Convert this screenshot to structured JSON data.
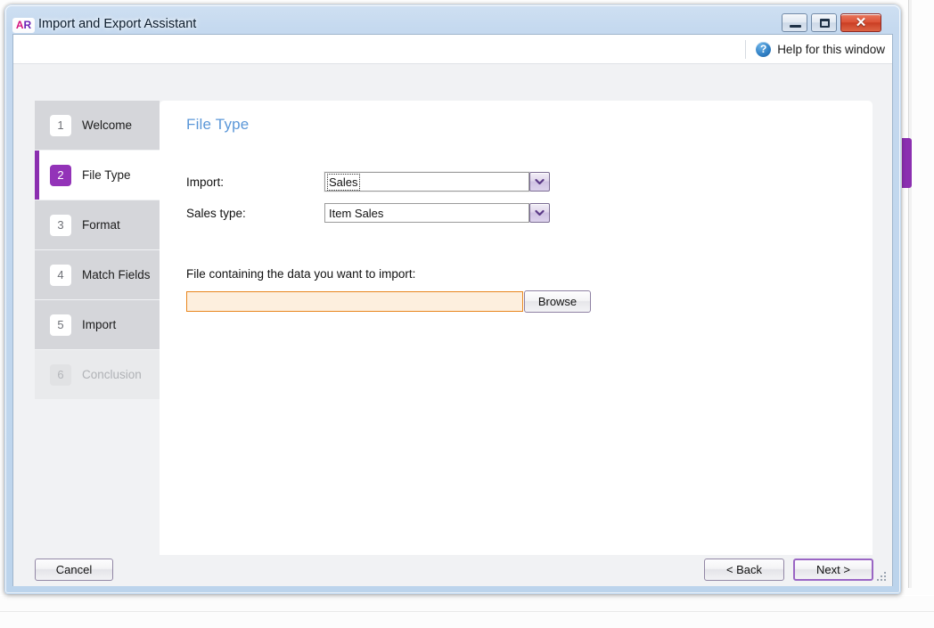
{
  "window": {
    "logo_text_1": "AR",
    "logo_part_a": "A",
    "logo_part_r": "R",
    "title": "Import and Export Assistant",
    "controls": {
      "minimize": "Minimize",
      "maximize": "Maximize",
      "close": "✕"
    }
  },
  "help": {
    "icon": "question-mark-icon",
    "icon_glyph": "?",
    "label": "Help for this window"
  },
  "sidebar": {
    "items": [
      {
        "number": "1",
        "label": "Welcome",
        "state": "normal"
      },
      {
        "number": "2",
        "label": "File Type",
        "state": "active"
      },
      {
        "number": "3",
        "label": "Format",
        "state": "normal"
      },
      {
        "number": "4",
        "label": "Match Fields",
        "state": "normal"
      },
      {
        "number": "5",
        "label": "Import",
        "state": "normal"
      },
      {
        "number": "6",
        "label": "Conclusion",
        "state": "disabled"
      }
    ]
  },
  "main": {
    "heading": "File Type",
    "fields": {
      "import": {
        "label": "Import:",
        "value": "Sales",
        "focused": true
      },
      "sales_type": {
        "label": "Sales type:",
        "value": "Item Sales",
        "focused": false
      },
      "file": {
        "label": "File containing the data you want to import:",
        "value": "",
        "placeholder": "",
        "browse_label": "Browse"
      }
    }
  },
  "footer": {
    "cancel_label": "Cancel",
    "back_label": "< Back",
    "next_label": "Next >"
  },
  "colors": {
    "accent_purple": "#8B2FB0",
    "badge_purple": "#9333B8",
    "heading_blue": "#5B97D8",
    "required_border": "#E8861E",
    "required_fill": "#FDEFDE",
    "frame_blue": "#bcd4ec",
    "close_red": "#dc5136",
    "sidebar_gray": "#d5d6da"
  }
}
